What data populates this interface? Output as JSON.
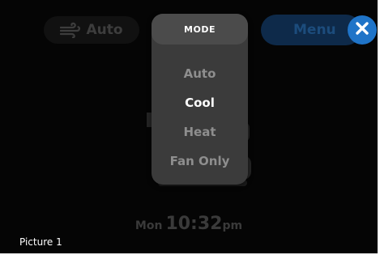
{
  "fan": {
    "label": "Auto",
    "icon": "fan-icon"
  },
  "menu": {
    "label": "Menu"
  },
  "close": {
    "icon": "close-icon"
  },
  "mode_panel": {
    "title": "MODE",
    "selected": "Cool",
    "options": [
      "Auto",
      "Cool",
      "Heat",
      "Fan Only"
    ]
  },
  "clock": {
    "day": "Mon",
    "time": "10:32",
    "ampm": "pm"
  },
  "caption": "Picture 1",
  "colors": {
    "background": "#050505",
    "panel": "#3b3b3b",
    "panel_header": "#4b4b4b",
    "close_button": "#1f74c8",
    "menu_button": "#0e2a4a"
  }
}
